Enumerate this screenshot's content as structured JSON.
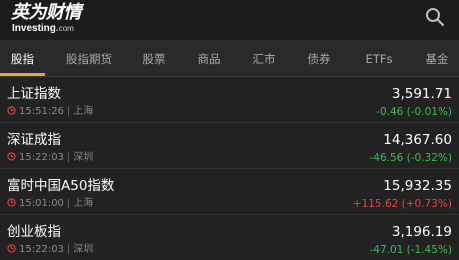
{
  "header": {
    "logo_text": "英为财情",
    "logo_sub": "Investing",
    "logo_sub_dot": ".",
    "logo_sub_com": "com"
  },
  "tabs": [
    {
      "label": "股指",
      "active": true
    },
    {
      "label": "股指期货",
      "active": false
    },
    {
      "label": "股票",
      "active": false
    },
    {
      "label": "商品",
      "active": false
    },
    {
      "label": "汇市",
      "active": false
    },
    {
      "label": "债券",
      "active": false
    },
    {
      "label": "ETFs",
      "active": false
    },
    {
      "label": "基金",
      "active": false
    }
  ],
  "quotes": [
    {
      "name": "上证指数",
      "time": "15:51:26",
      "exchange": "上海",
      "price": "3,591.71",
      "change": "-0.46 (-0.01%)",
      "direction": "down"
    },
    {
      "name": "深证成指",
      "time": "15:22:03",
      "exchange": "深圳",
      "price": "14,367.60",
      "change": "-46.56 (-0.32%)",
      "direction": "down"
    },
    {
      "name": "富时中国A50指数",
      "time": "15:01:00",
      "exchange": "上海",
      "price": "15,932.35",
      "change": "+115.62 (+0.73%)",
      "direction": "up"
    },
    {
      "name": "创业板指",
      "time": "15:22:03",
      "exchange": "深圳",
      "price": "3,196.19",
      "change": "-47.01 (-1.45%)",
      "direction": "down"
    }
  ],
  "colors": {
    "accent": "#f5a623",
    "positive": "#e84141",
    "negative": "#3dbb4f",
    "background": "#222222"
  }
}
